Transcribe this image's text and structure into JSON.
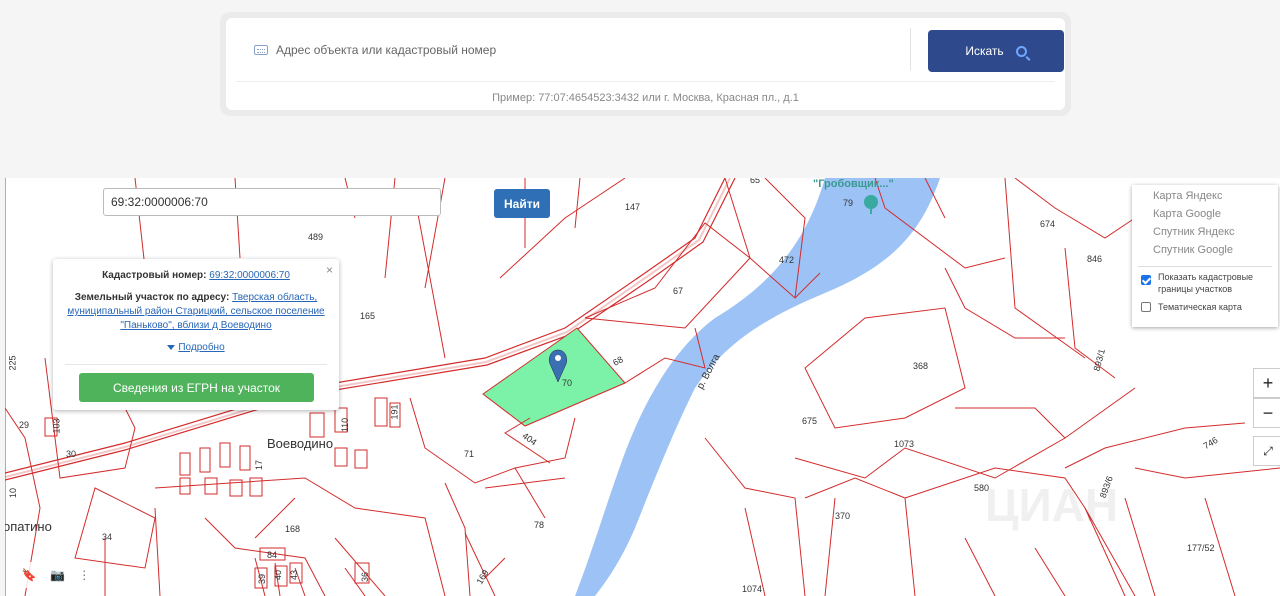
{
  "search": {
    "placeholder": "Адрес объекта или кадастровый номер",
    "button_label": "Искать",
    "example": "Пример: 77:07:4654523:3432 или г. Москва, Красная пл., д.1"
  },
  "map": {
    "coord_value": "69:32:0000006:70",
    "find_label": "Найти",
    "popup": {
      "cad_label": "Кадастровый номер:",
      "cad_value": "69:32:0000006:70",
      "addr_label": "Земельный участок по адресу:",
      "addr_value": "Тверская область, муниципальный район Старицкий, сельское поселение \"Паньково\", вблизи д Воеводино",
      "more": "Подробно",
      "egrn_button": "Сведения из ЕГРН на участок",
      "close": "×"
    },
    "layers": {
      "items": [
        "Карта Яндекс",
        "Карта Google",
        "Спутник Яндекс",
        "Спутник Google"
      ],
      "show_cadastral": "Показать кадастровые границы участков",
      "thematic": "Тематическая карта"
    },
    "zoom_in": "+",
    "zoom_out": "−",
    "labels": {
      "village": "Воеводино",
      "village2": "опатино",
      "river": "р. Волга",
      "poi": "\"Гробовщик...\"",
      "watermark": "ЦИАН"
    },
    "parcels": [
      "147",
      "489",
      "165",
      "67",
      "472",
      "68",
      "70",
      "404",
      "71",
      "78",
      "168",
      "34",
      "30",
      "29",
      "225",
      "103",
      "10",
      "84",
      "40",
      "43",
      "39",
      "36",
      "675",
      "368",
      "1073",
      "370",
      "580",
      "674",
      "846",
      "893/1",
      "893/6",
      "746",
      "177/52",
      "1074",
      "169",
      "79",
      "65",
      "110",
      "191",
      "17"
    ]
  },
  "colors": {
    "accent": "#2f4a8c",
    "find": "#2e6fb5",
    "egrn": "#4fb35c",
    "parcel_line": "#d42b2b",
    "river": "#9cc2f6",
    "selected_parcel": "#7cf2a8"
  }
}
